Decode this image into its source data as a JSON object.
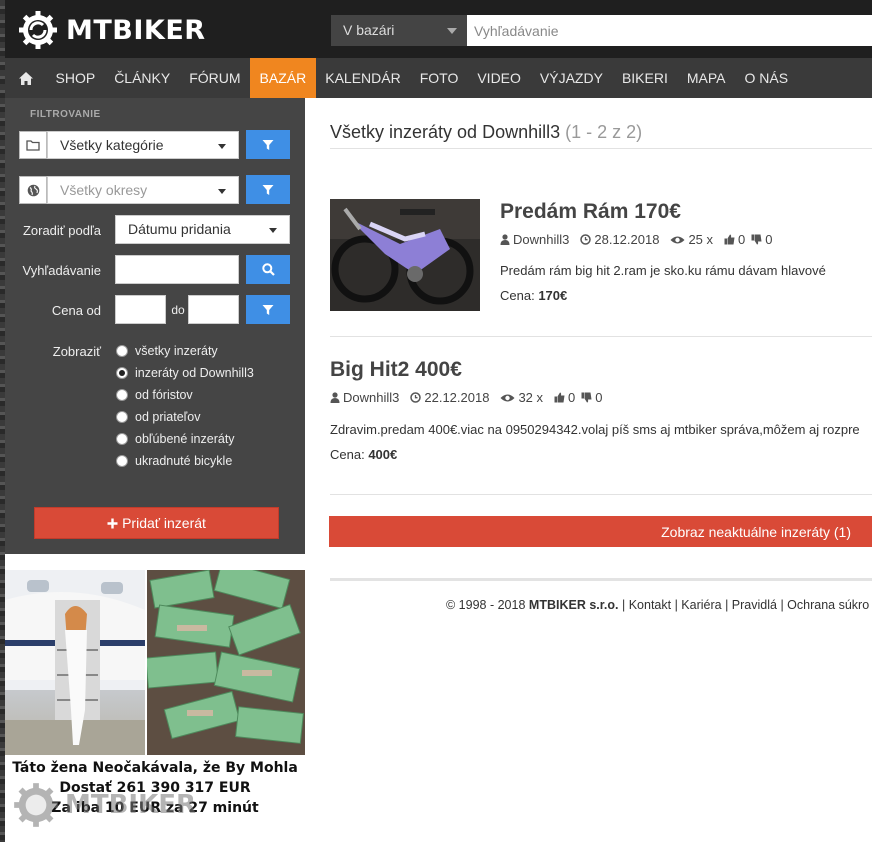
{
  "site": {
    "name": "MTBIKER"
  },
  "header": {
    "scope_select": "V bazári",
    "search_placeholder": "Vyhľadávanie"
  },
  "nav": {
    "items": [
      "SHOP",
      "ČLÁNKY",
      "FÓRUM",
      "BAZÁR",
      "KALENDÁR",
      "FOTO",
      "VIDEO",
      "VÝJAZDY",
      "BIKERI",
      "MAPA",
      "O NÁS"
    ],
    "active": "BAZÁR"
  },
  "sidebar": {
    "heading": "FILTROVANIE",
    "category": "Všetky kategórie",
    "district": "Všetky okresy",
    "sort_label": "Zoradiť podľa",
    "sort_value": "Dátumu pridania",
    "search_label": "Vyhľadávanie",
    "price_label": "Cena od",
    "price_to": "do",
    "show_label": "Zobraziť",
    "options": [
      "všetky inzeráty",
      "inzeráty od Downhill3",
      "od fóristov",
      "od priateľov",
      "obľúbené inzeráty",
      "ukradnuté bicykle"
    ],
    "selected_option": 1,
    "add_button": "Pridať inzerát"
  },
  "ad": {
    "line1": "Táto žena Neočakávala, že By Mohla",
    "line2": "Dostať 261 390 317 EUR",
    "line3": "Za iba 10 EUR za 27 minút",
    "watermark": "MTBIKER"
  },
  "main": {
    "title": "Všetky inzeráty od Downhill3",
    "range": "(1 - 2 z 2)",
    "listings": [
      {
        "title": "Predám Rám 170€",
        "user": "Downhill3",
        "date": "28.12.2018",
        "views": "25 x",
        "likes": "0",
        "dislikes": "0",
        "description": "Predám rám big hit 2.ram je sko.ku rámu dávam hlavové",
        "price_label": "Cena:",
        "price": "170€"
      },
      {
        "title": "Big Hit2 400€",
        "user": "Downhill3",
        "date": "22.12.2018",
        "views": "32 x",
        "likes": "0",
        "dislikes": "0",
        "description": "Zdravim.predam 400€.viac na 0950294342.volaj píš sms aj mtbiker správa,môžem aj rozpre",
        "price_label": "Cena:",
        "price": "400€"
      }
    ],
    "inactive_button": "Zobraz neaktuálne inzeráty (1)"
  },
  "footer": {
    "copyright": "© 1998 - 2018",
    "company": "MTBIKER s.r.o.",
    "links": [
      "Kontakt",
      "Kariéra",
      "Pravidlá",
      "Ochrana súkro"
    ]
  },
  "colors": {
    "accent_orange": "#f0861f",
    "red": "#d94a37",
    "blue": "#3f8fe5",
    "dark": "#1f1f1f"
  }
}
